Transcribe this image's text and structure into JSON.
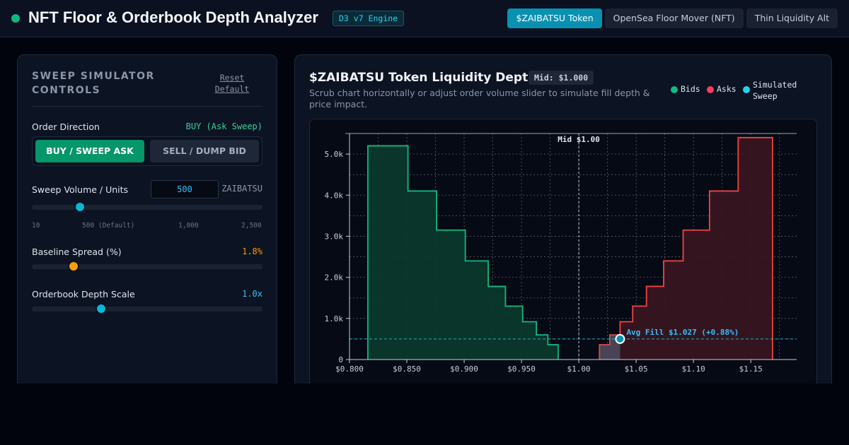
{
  "header": {
    "title": "NFT Floor & Orderbook Depth Analyzer",
    "engine_badge": "D3 v7 Engine",
    "tabs": [
      {
        "label": "$ZAIBATSU Token",
        "active": true
      },
      {
        "label": "OpenSea Floor Mover (NFT)",
        "active": false
      },
      {
        "label": "Thin Liquidity Alt",
        "active": false
      }
    ]
  },
  "controls": {
    "title": "SWEEP SIMULATOR CONTROLS",
    "reset_label": "Reset Default",
    "direction": {
      "label": "Order Direction",
      "value": "BUY (Ask Sweep)",
      "buy_label": "BUY / SWEEP ASK",
      "sell_label": "SELL / DUMP BID"
    },
    "volume": {
      "label": "Sweep Volume / Units",
      "value": "500",
      "unit": "ZAIBATSU",
      "slider_fraction": 0.21,
      "ticks": [
        "10",
        "500 (Default)",
        "1,000",
        "2,500"
      ]
    },
    "spread": {
      "label": "Baseline Spread (%)",
      "value": "1.8%",
      "slider_fraction": 0.18
    },
    "depth": {
      "label": "Orderbook Depth Scale",
      "value": "1.0x",
      "slider_fraction": 0.3
    }
  },
  "chart": {
    "title": "$ZAIBATSU Token Liquidity Depth",
    "mid_badge": "Mid: $1.000",
    "subtitle": "Scrub chart horizontally or adjust order volume slider to simulate fill depth & price impact.",
    "legend": [
      {
        "label": "Bids",
        "color": "#10b981"
      },
      {
        "label": "Asks",
        "color": "#f43f5e"
      },
      {
        "label": "Simulated Sweep",
        "color": "#22d3ee"
      }
    ]
  },
  "chart_data": {
    "type": "area",
    "xlim": [
      0.8,
      1.19
    ],
    "ylim": [
      0,
      5500
    ],
    "x_ticks": [
      0.8,
      0.85,
      0.9,
      0.95,
      1.0,
      1.05,
      1.1,
      1.15
    ],
    "x_tick_labels": [
      "$0.800",
      "$0.850",
      "$0.900",
      "$0.950",
      "$1.00",
      "$1.05",
      "$1.10",
      "$1.15"
    ],
    "y_ticks": [
      0,
      1000,
      2000,
      3000,
      4000,
      5000
    ],
    "y_tick_labels": [
      "0",
      "1.0k",
      "2.0k",
      "3.0k",
      "4.0k",
      "5.0k"
    ],
    "grid": true,
    "series": [
      {
        "name": "Bids",
        "color": "#10b981",
        "x": [
          0.816,
          0.851,
          0.876,
          0.901,
          0.921,
          0.936,
          0.951,
          0.963,
          0.973,
          0.982
        ],
        "y": [
          5200,
          4100,
          3150,
          2400,
          1780,
          1300,
          920,
          600,
          360,
          0
        ]
      },
      {
        "name": "Asks",
        "color": "#f43f5e",
        "x": [
          1.018,
          1.027,
          1.036,
          1.047,
          1.059,
          1.074,
          1.091,
          1.114,
          1.139,
          1.169
        ],
        "y": [
          360,
          600,
          920,
          1300,
          1780,
          2400,
          3150,
          4100,
          5400,
          0
        ]
      }
    ],
    "mid_price": 1.0,
    "mid_label": "Mid $1.00",
    "sweep": {
      "volume": 500,
      "start": 1.018,
      "end": 1.036,
      "avg_fill_label": "Avg Fill $1.027 (+0.88%)"
    }
  },
  "colors": {
    "accent": "#0891b2",
    "buy": "#059669",
    "bid_line": "#10b981",
    "ask_line": "#ef4444",
    "sweep": "#22d3ee",
    "spread_thumb": "#f59e0b"
  }
}
